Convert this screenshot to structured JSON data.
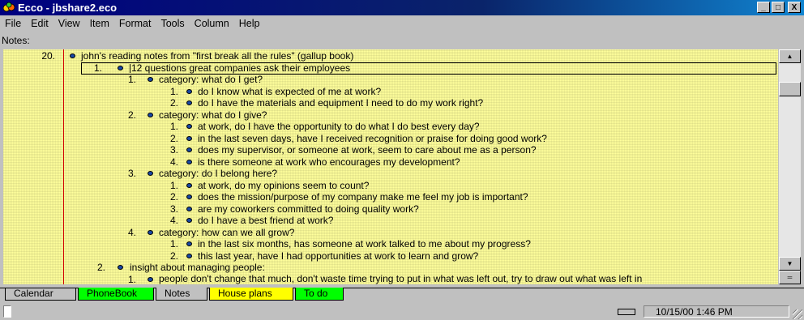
{
  "window": {
    "title": "Ecco - jbshare2.eco",
    "controls": {
      "minimize": "_",
      "maximize": "□",
      "close": "X"
    }
  },
  "menu": [
    "File",
    "Edit",
    "View",
    "Item",
    "Format",
    "Tools",
    "Column",
    "Help"
  ],
  "notes_label": "Notes:",
  "outline": [
    {
      "num": "20.",
      "text": "john's reading notes from \"first break all the rules\" (gallup book)",
      "level": 0
    },
    {
      "num": "1.",
      "text": "12 questions great companies ask their employees",
      "level": 1,
      "selected": true
    },
    {
      "num": "1.",
      "text": "category: what do I get?",
      "level": 2
    },
    {
      "num": "1.",
      "text": "do I know what is expected of me at work?",
      "level": 3
    },
    {
      "num": "2.",
      "text": "do I have the materials and equipment I need to do my work right?",
      "level": 3
    },
    {
      "num": "2.",
      "text": "category: what do I give?",
      "level": 2
    },
    {
      "num": "1.",
      "text": "at work, do I have the opportunity to do what I do best every day?",
      "level": 3
    },
    {
      "num": "2.",
      "text": "in the last seven days, have I received recognition or praise for doing good work?",
      "level": 3
    },
    {
      "num": "3.",
      "text": "does my supervisor, or someone at work, seem to care about me as a person?",
      "level": 3
    },
    {
      "num": "4.",
      "text": "is there someone at work who encourages my development?",
      "level": 3
    },
    {
      "num": "3.",
      "text": "category: do I belong here?",
      "level": 2
    },
    {
      "num": "1.",
      "text": "at work, do my opinions seem to count?",
      "level": 3
    },
    {
      "num": "2.",
      "text": "does the mission/purpose of my company make me feel my job is important?",
      "level": 3
    },
    {
      "num": "3.",
      "text": "are my coworkers committed to doing quality work?",
      "level": 3
    },
    {
      "num": "4.",
      "text": "do I have a best friend at work?",
      "level": 3
    },
    {
      "num": "4.",
      "text": "category: how can we all grow?",
      "level": 2
    },
    {
      "num": "1.",
      "text": "in the last six months, has someone at work talked to me about my progress?",
      "level": 3
    },
    {
      "num": "2.",
      "text": "this last year, have I had opportunities at work to learn and grow?",
      "level": 3
    },
    {
      "num": "2.",
      "text": "insight about managing people:",
      "level": 1
    },
    {
      "num": "1.",
      "text": "people don't change that much, don't waste time trying to put in what was left out, try to draw out what was left in",
      "level": 2,
      "wrap": true
    }
  ],
  "tabs": [
    {
      "label": "Calendar",
      "style": "plain"
    },
    {
      "label": "PhoneBook",
      "style": "green"
    },
    {
      "label": "Notes",
      "style": "active"
    },
    {
      "label": "House plans",
      "style": "yellow"
    },
    {
      "label": "To do",
      "style": "green"
    }
  ],
  "status": {
    "datetime": "10/15/00 1:46 PM"
  },
  "colors": {
    "outline_bg": "#ffff9c",
    "bullet": "#1848a8",
    "margin_line": "#d00000",
    "tab_green": "#00ff00",
    "tab_yellow": "#ffff00"
  }
}
